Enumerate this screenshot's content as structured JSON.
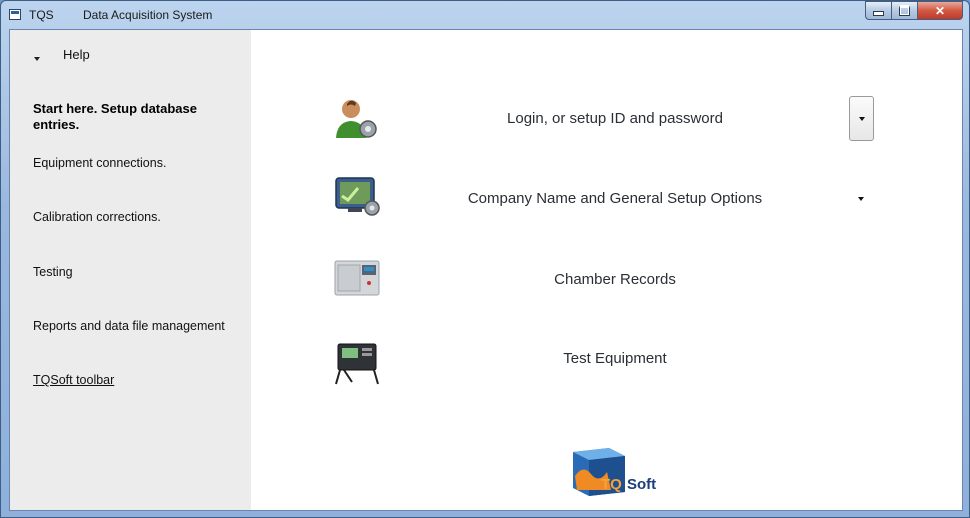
{
  "window": {
    "app_name": "TQS",
    "title": "Data Acquisition System"
  },
  "sidebar": {
    "help_label": "Help",
    "start_heading": "Start here. Setup database entries.",
    "items": [
      {
        "label": "Equipment connections."
      },
      {
        "label": "Calibration corrections."
      },
      {
        "label": "Testing"
      },
      {
        "label": "Reports and data file management"
      }
    ],
    "toolbar_link": "TQSoft toolbar"
  },
  "main": {
    "rows": [
      {
        "label": "Login, or setup ID and password",
        "icon": "user-gear-icon"
      },
      {
        "label": "Company Name and General Setup Options",
        "icon": "monitor-gear-icon"
      },
      {
        "label": "Chamber Records",
        "icon": "chamber-icon"
      },
      {
        "label": "Test Equipment",
        "icon": "data-logger-icon"
      }
    ],
    "logo_text_1": "TQ",
    "logo_text_2": "Soft"
  },
  "colors": {
    "title_bar": "#9ab8de",
    "sidebar_bg": "#ececec",
    "close_button": "#c0392b",
    "label_text": "#2a2e36"
  }
}
